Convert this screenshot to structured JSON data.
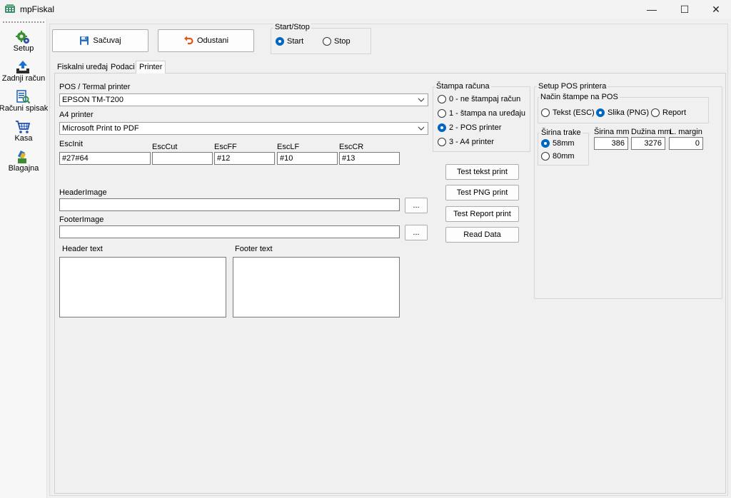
{
  "window": {
    "title": "mpFiskal",
    "controls": {
      "minimize": "—",
      "maximize": "☐",
      "close": "✕"
    }
  },
  "sidebar": {
    "items": [
      {
        "label": "Setup",
        "icon": "gears-icon"
      },
      {
        "label": "Zadnji račun",
        "icon": "upload-tray-icon"
      },
      {
        "label": "Računi spisak",
        "icon": "document-search-icon"
      },
      {
        "label": "Kasa",
        "icon": "shopping-cart-icon"
      },
      {
        "label": "Blagajna",
        "icon": "cash-register-icon"
      }
    ]
  },
  "toolbar": {
    "save_label": "Sačuvaj",
    "cancel_label": "Odustani"
  },
  "start_stop": {
    "legend": "Start/Stop",
    "options": [
      "Start",
      "Stop"
    ],
    "selected": "Start"
  },
  "tabs": [
    {
      "label": "Fiskalni uređaj",
      "active": false
    },
    {
      "label": "Podaci",
      "active": false
    },
    {
      "label": "Printer",
      "active": true
    }
  ],
  "printer": {
    "pos_label": "POS / Termal printer",
    "pos_value": "EPSON TM-T200",
    "a4_label": "A4 printer",
    "a4_value": "Microsoft Print to PDF",
    "esc": {
      "init_label": "EscInit",
      "init_value": "#27#64",
      "cut_label": "EscCut",
      "cut_value": "",
      "ff_label": "EscFF",
      "ff_value": "#12",
      "lf_label": "EscLF",
      "lf_value": "#10",
      "cr_label": "EscCR",
      "cr_value": "#13"
    },
    "header_image_label": "HeaderImage",
    "header_image_value": "",
    "footer_image_label": "FooterImage",
    "footer_image_value": "",
    "browse_label": "...",
    "header_text_label": "Header text",
    "footer_text_label": "Footer text"
  },
  "stampa": {
    "legend": "Štampa računa",
    "options": [
      "0 - ne štampaj račun",
      "1 - štampa na uređaju",
      "2 - POS printer",
      "3 - A4 printer"
    ],
    "selected_index": 2
  },
  "test_buttons": {
    "text": "Test tekst print",
    "png": "Test PNG print",
    "report": "Test Report print",
    "read": "Read Data"
  },
  "setup_pos": {
    "legend": "Setup POS printera",
    "mode_legend": "Način štampe na POS",
    "modes": [
      "Tekst (ESC)",
      "Slika (PNG)",
      "Report"
    ],
    "selected_mode": 1,
    "width_legend": "Širina trake",
    "widths": [
      "58mm",
      "80mm"
    ],
    "selected_width": 0,
    "sirina_label": "Širina mm",
    "sirina_value": "386",
    "duzina_label": "Dužina mm",
    "duzina_value": "3276",
    "margin_label": "L. margin",
    "margin_value": "0"
  },
  "colors": {
    "accent": "#0067c0",
    "save_icon": "#2a6fbf",
    "cancel_icon": "#e2561c"
  }
}
